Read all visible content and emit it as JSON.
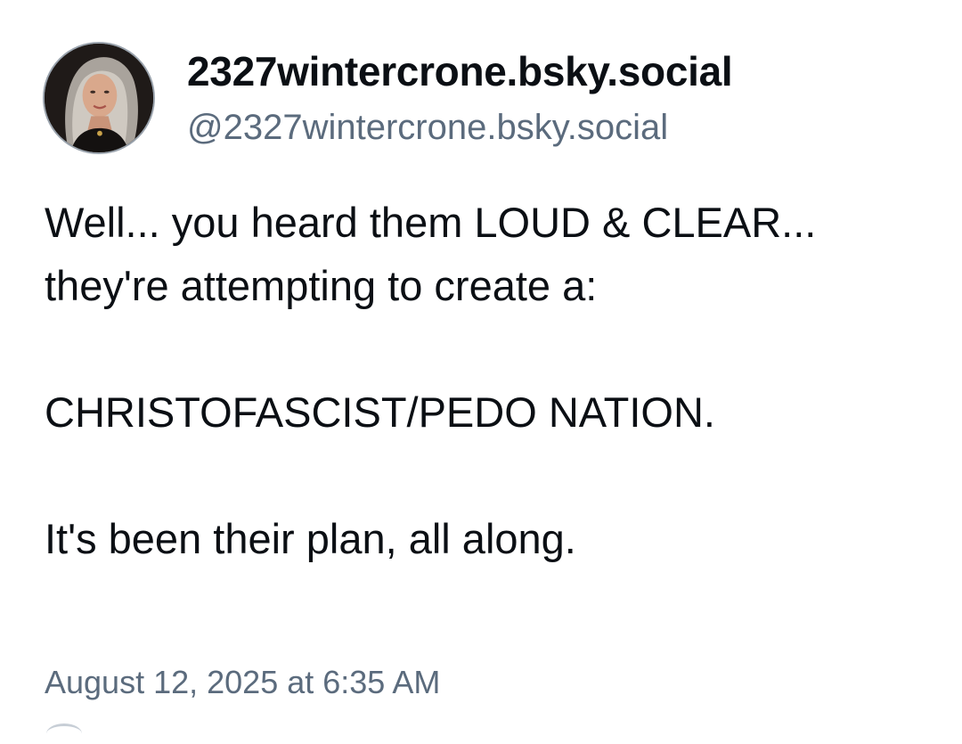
{
  "post": {
    "author": {
      "display_name": "2327wintercrone.bsky.social",
      "handle": "@2327wintercrone.bsky.social",
      "avatar_icon": "profile-photo"
    },
    "text": {
      "line1": "Well... you heard them LOUD & CLEAR... they're attempting to create a:",
      "line2": "CHRISTOFASCIST/PEDO NATION.",
      "line3": "It's been their plan, all along."
    },
    "timestamp": "August 12, 2025 at 6:35 AM"
  },
  "colors": {
    "text_primary": "#0b0f14",
    "text_secondary": "#5b6b7d",
    "background": "#ffffff"
  }
}
